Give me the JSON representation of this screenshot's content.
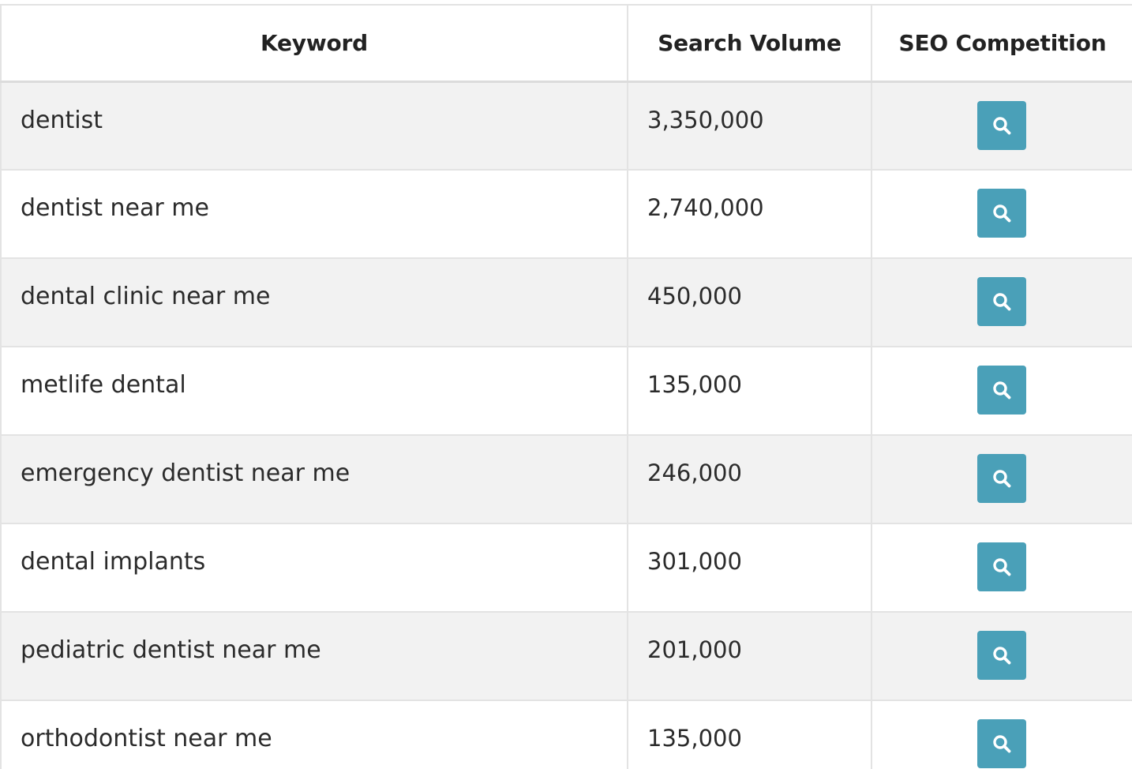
{
  "table": {
    "headers": {
      "keyword": "Keyword",
      "search_volume": "Search Volume",
      "seo_competition": "SEO Competition"
    },
    "rows": [
      {
        "keyword": "dentist",
        "volume": "3,350,000"
      },
      {
        "keyword": "dentist near me",
        "volume": "2,740,000"
      },
      {
        "keyword": "dental clinic near me",
        "volume": "450,000"
      },
      {
        "keyword": "metlife dental",
        "volume": "135,000"
      },
      {
        "keyword": "emergency dentist near me",
        "volume": "246,000"
      },
      {
        "keyword": "dental implants",
        "volume": "301,000"
      },
      {
        "keyword": "pediatric dentist near me",
        "volume": "201,000"
      },
      {
        "keyword": "orthodontist near me",
        "volume": "135,000"
      }
    ],
    "action_icon": "search-icon"
  },
  "colors": {
    "button": "#4aa0b8",
    "stripe": "#f2f2f2",
    "border": "#e3e3e3"
  }
}
